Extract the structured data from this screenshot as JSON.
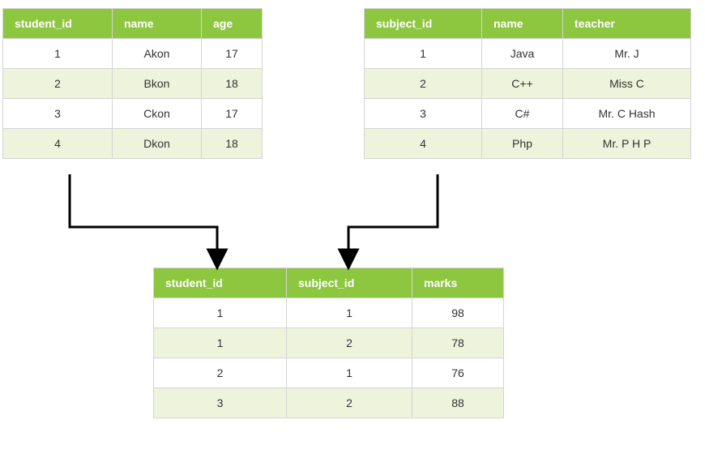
{
  "tables": {
    "students": {
      "headers": [
        "student_id",
        "name",
        "age"
      ],
      "rows": [
        [
          "1",
          "Akon",
          "17"
        ],
        [
          "2",
          "Bkon",
          "18"
        ],
        [
          "3",
          "Ckon",
          "17"
        ],
        [
          "4",
          "Dkon",
          "18"
        ]
      ]
    },
    "subjects": {
      "headers": [
        "subject_id",
        "name",
        "teacher"
      ],
      "rows": [
        [
          "1",
          "Java",
          "Mr. J"
        ],
        [
          "2",
          "C++",
          "Miss C"
        ],
        [
          "3",
          "C#",
          "Mr. C Hash"
        ],
        [
          "4",
          "Php",
          "Mr. P H P"
        ]
      ]
    },
    "marks": {
      "headers": [
        "student_id",
        "subject_id",
        "marks"
      ],
      "rows": [
        [
          "1",
          "1",
          "98"
        ],
        [
          "1",
          "2",
          "78"
        ],
        [
          "2",
          "1",
          "76"
        ],
        [
          "3",
          "2",
          "88"
        ]
      ]
    }
  },
  "colors": {
    "header_bg": "#8dc63f",
    "header_text": "#ffffff",
    "row_alt_bg": "#eef3dc",
    "border": "#d4d4d4"
  }
}
